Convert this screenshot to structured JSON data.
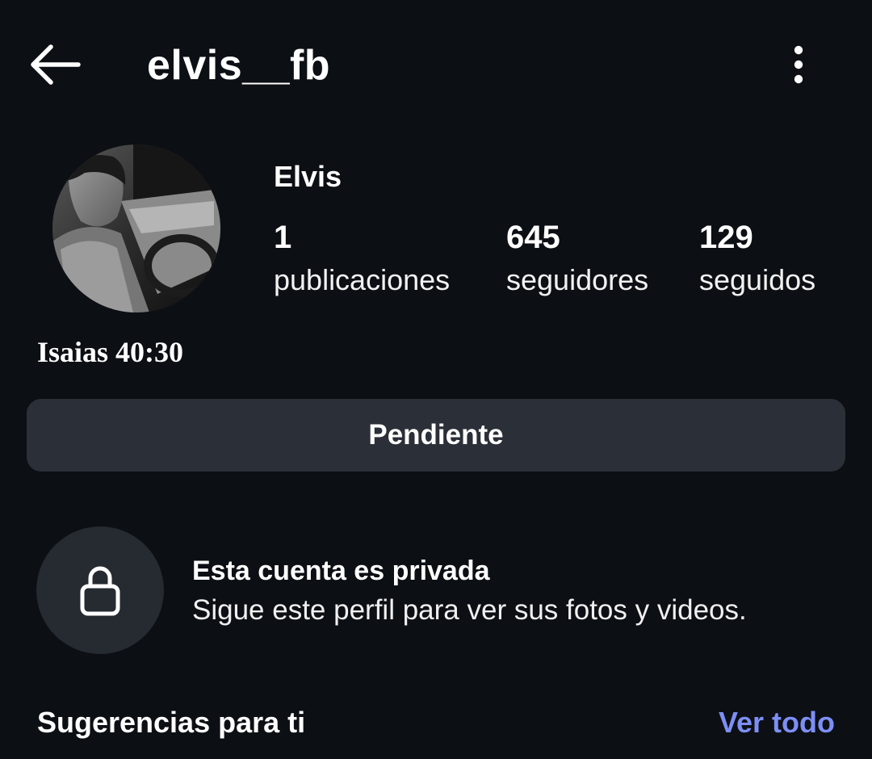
{
  "header": {
    "username": "elvis__fb",
    "back_icon": "arrow-left-icon",
    "menu_icon": "more-vertical-icon"
  },
  "profile": {
    "display_name": "Elvis",
    "stats": {
      "posts": {
        "value": "1",
        "label": "publicaciones"
      },
      "followers": {
        "value": "645",
        "label": "seguidores"
      },
      "following": {
        "value": "129",
        "label": "seguidos"
      }
    },
    "bio": "Isaias 40:30"
  },
  "actions": {
    "follow_status_label": "Pendiente"
  },
  "private_notice": {
    "icon": "lock-icon",
    "title": "Esta cuenta es privada",
    "subtitle": "Sigue este perfil para ver sus fotos y videos."
  },
  "suggestions": {
    "title": "Sugerencias para ti",
    "see_all_label": "Ver todo"
  },
  "colors": {
    "background": "#0c0f14",
    "button_bg": "#2b2f37",
    "lock_circle_bg": "#262a31",
    "link": "#7d8ff5",
    "text": "#ffffff"
  }
}
